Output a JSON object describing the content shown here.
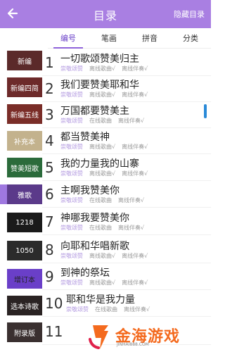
{
  "header": {
    "title": "目录",
    "hide_label": "隐藏目录"
  },
  "tabs": [
    {
      "label": "编号",
      "active": true
    },
    {
      "label": "笔画",
      "active": false
    },
    {
      "label": "拼音",
      "active": false
    },
    {
      "label": "分类",
      "active": false
    }
  ],
  "sidebar": {
    "items": [
      {
        "label": "新编",
        "color": "#5b2a2a"
      },
      {
        "label": "新编四简",
        "color": "#6d2a2a"
      },
      {
        "label": "新编五线",
        "color": "#7a2d28"
      },
      {
        "label": "补充本",
        "color": "#c3b28d"
      },
      {
        "label": "赞美短歌",
        "color": "#2b6b3b"
      },
      {
        "label": "雅歌",
        "color": "#5b3a8a"
      },
      {
        "label": "1218",
        "color": "#1a1a1a"
      },
      {
        "label": "1050",
        "color": "#2b2b2b"
      },
      {
        "label": "增订本",
        "color": "#6a3fc8",
        "text_color": "#222222"
      },
      {
        "label": "选本诗歌",
        "color": "#2a2323"
      },
      {
        "label": "附录版",
        "color": "#3a3030"
      }
    ]
  },
  "songs": [
    {
      "num": "1",
      "title": "一切歌颂赞美归主",
      "tags": [
        "崇敬颂赞",
        "离线歌曲√",
        "离线伴奏√"
      ]
    },
    {
      "num": "2",
      "title": "我们要赞美耶和华",
      "tags": [
        "崇敬颂赞",
        "离线歌曲√",
        "离线伴奏√"
      ]
    },
    {
      "num": "3",
      "title": "万国都要赞美主",
      "tags": [
        "崇敬颂赞",
        "在线歌曲",
        "离线伴奏√"
      ]
    },
    {
      "num": "4",
      "title": "都当赞美神",
      "tags": [
        "崇敬颂赞",
        "离线歌曲√",
        "离线伴奏√"
      ]
    },
    {
      "num": "5",
      "title": "我的力量我的山寨",
      "tags": [
        "崇敬颂赞",
        "离线歌曲√",
        "离线伴奏√"
      ]
    },
    {
      "num": "6",
      "title": "主啊我赞美你",
      "tags": [
        "崇敬颂赞",
        "在线歌曲",
        "离线伴奏√"
      ]
    },
    {
      "num": "7",
      "title": "神哪我要赞美你",
      "tags": [
        "崇敬颂赞",
        "在线歌曲",
        "离线伴奏√"
      ]
    },
    {
      "num": "8",
      "title": "向耶和华唱新歌",
      "tags": [
        "崇敬颂赞",
        "离线歌曲√",
        "离线伴奏√"
      ]
    },
    {
      "num": "9",
      "title": "到神的祭坛",
      "tags": [
        "崇敬颂赞",
        "离线歌曲√",
        "离线伴奏√"
      ]
    },
    {
      "num": "10",
      "title": "耶和华是我力量",
      "tags": [
        "崇敬颂赞",
        "在线歌曲",
        "离线伴奏√"
      ]
    },
    {
      "num": "11",
      "title": "",
      "tags": []
    }
  ],
  "watermark": {
    "brand": "金海游戏",
    "url": "JINHAI888.COM"
  },
  "colors": {
    "accent": "#a97fe2",
    "tab_active": "#6a40c8",
    "tag": "#b39ae0",
    "scroll": "#2a8ad8"
  }
}
